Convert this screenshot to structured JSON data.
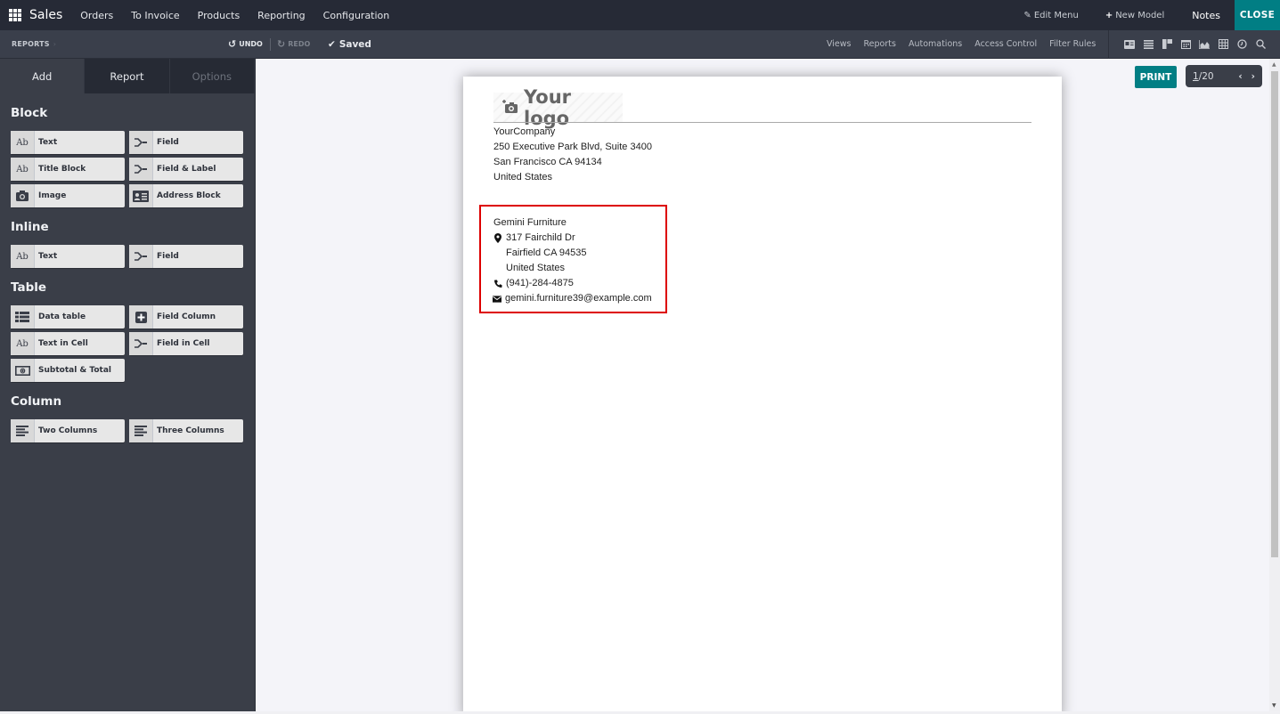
{
  "topbar": {
    "brand": "Sales",
    "menu": [
      "Orders",
      "To Invoice",
      "Products",
      "Reporting",
      "Configuration"
    ],
    "edit_menu": "Edit Menu",
    "new_model": "New Model",
    "notes": "Notes",
    "close": "CLOSE"
  },
  "subbar": {
    "breadcrumb": "REPORTS",
    "undo": "UNDO",
    "redo": "REDO",
    "saved": "Saved",
    "nav": [
      "Views",
      "Reports",
      "Automations",
      "Access Control",
      "Filter Rules"
    ],
    "view_icons": [
      "form-view-icon",
      "list-view-icon",
      "kanban-view-icon",
      "calendar-view-icon",
      "graph-view-icon",
      "pivot-view-icon",
      "activity-view-icon",
      "search-view-icon"
    ]
  },
  "sidebar": {
    "tabs": [
      {
        "label": "Add",
        "state": "active"
      },
      {
        "label": "Report",
        "state": "normal"
      },
      {
        "label": "Options",
        "state": "disabled"
      }
    ],
    "sections": [
      {
        "title": "Block",
        "items": [
          {
            "icon": "Ab",
            "icon_name": "text-icon",
            "label": "Text"
          },
          {
            "icon": "field",
            "icon_name": "field-icon",
            "label": "Field"
          },
          {
            "icon": "Ab",
            "icon_name": "text-icon",
            "label": "Title Block"
          },
          {
            "icon": "field",
            "icon_name": "field-icon",
            "label": "Field & Label"
          },
          {
            "icon": "camera",
            "icon_name": "camera-icon",
            "label": "Image"
          },
          {
            "icon": "address",
            "icon_name": "address-card-icon",
            "label": "Address Block"
          }
        ]
      },
      {
        "title": "Inline",
        "items": [
          {
            "icon": "Ab",
            "icon_name": "text-icon",
            "label": "Text"
          },
          {
            "icon": "field",
            "icon_name": "field-icon",
            "label": "Field"
          }
        ]
      },
      {
        "title": "Table",
        "items": [
          {
            "icon": "table",
            "icon_name": "data-table-icon",
            "label": "Data table"
          },
          {
            "icon": "plus",
            "icon_name": "plus-square-icon",
            "label": "Field Column"
          },
          {
            "icon": "Ab",
            "icon_name": "text-icon",
            "label": "Text in Cell"
          },
          {
            "icon": "field",
            "icon_name": "field-icon",
            "label": "Field in Cell"
          },
          {
            "icon": "money",
            "icon_name": "money-icon",
            "label": "Subtotal & Total"
          }
        ]
      },
      {
        "title": "Column",
        "items": [
          {
            "icon": "columns",
            "icon_name": "align-left-icon",
            "label": "Two Columns"
          },
          {
            "icon": "columns",
            "icon_name": "align-left-icon",
            "label": "Three Columns"
          }
        ]
      }
    ]
  },
  "report": {
    "logo_text": "Your logo",
    "company": [
      "YourCompany",
      "250 Executive Park Blvd, Suite 3400",
      "San Francisco CA 94134",
      "United States"
    ],
    "partner": {
      "name": "Gemini Furniture",
      "street": "317 Fairchild Dr",
      "city": "Fairfield CA 94535",
      "country": "United States",
      "phone": "(941)-284-4875",
      "email": "gemini.furniture39@example.com"
    },
    "print": "PRINT",
    "pager": {
      "current": "1",
      "total": "20"
    }
  },
  "colors": {
    "accent": "#017e84",
    "selection_border": "#dd0000",
    "topbar_bg": "#262a36",
    "sidebar_bg": "#3a3e48"
  }
}
